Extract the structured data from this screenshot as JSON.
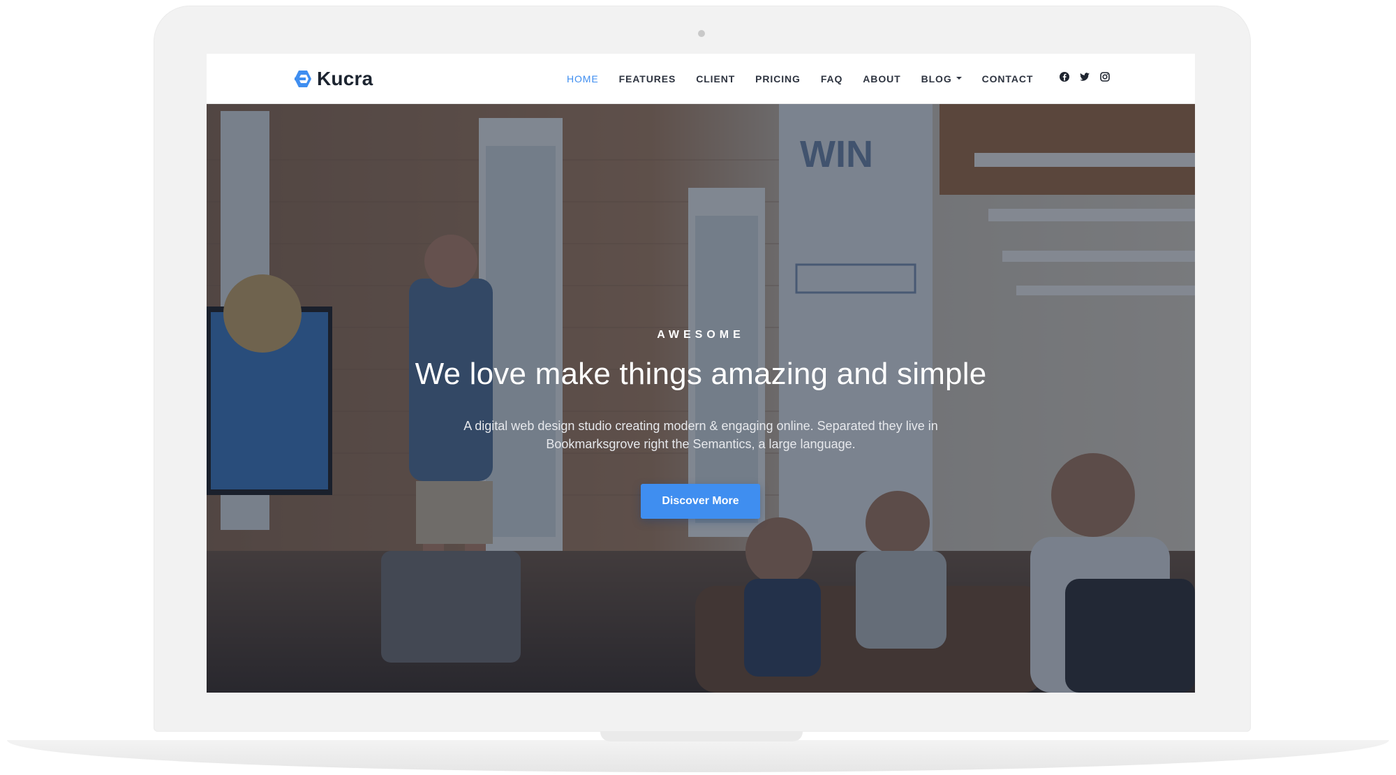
{
  "brand": {
    "name": "Kucra",
    "logo_icon": "hexagon-logo-icon",
    "accent_color": "#3f8ef0"
  },
  "nav": {
    "items": [
      {
        "label": "HOME",
        "active": true
      },
      {
        "label": "FEATURES",
        "active": false
      },
      {
        "label": "CLIENT",
        "active": false
      },
      {
        "label": "PRICING",
        "active": false
      },
      {
        "label": "FAQ",
        "active": false
      },
      {
        "label": "ABOUT",
        "active": false
      },
      {
        "label": "BLOG",
        "active": false,
        "has_dropdown": true
      },
      {
        "label": "CONTACT",
        "active": false
      }
    ],
    "social_icons": [
      "facebook-icon",
      "twitter-icon",
      "instagram-icon"
    ]
  },
  "hero": {
    "eyebrow": "AWESOME",
    "title": "We love make things amazing and simple",
    "description": "A digital web design studio creating modern & engaging online. Separated they live in Bookmarksgrove right the Semantics, a large language.",
    "cta_label": "Discover More",
    "cta_color": "#3f8ef0"
  }
}
